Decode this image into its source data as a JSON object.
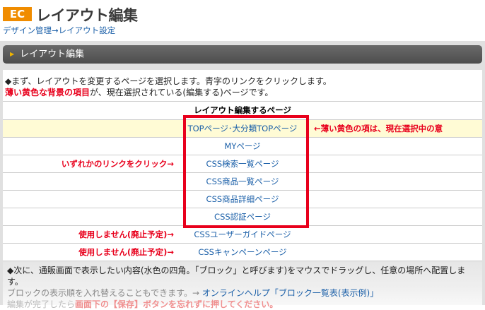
{
  "header": {
    "badge": "EC",
    "title": "レイアウト編集",
    "breadcrumb": "デザイン管理→レイアウト設定"
  },
  "section": {
    "title": "レイアウト編集"
  },
  "intro": {
    "line1": "◆まず、レイアウトを変更するページを選択します。青字のリンクをクリックします。",
    "line2_red": "薄い黄色な背景の項目",
    "line2_rest": "が、現在選択されている(編集する)ページです。"
  },
  "table": {
    "header": "レイアウト編集するページ",
    "rows": [
      {
        "label": "TOPページ･大分類TOPページ",
        "selected": true,
        "right_note": "←薄い黄色の項は、現在選択中の意"
      },
      {
        "label": "MYページ"
      },
      {
        "label": "CSS検索一覧ページ",
        "left_note": "いずれかのリンクをクリック→"
      },
      {
        "label": "CSS商品一覧ページ"
      },
      {
        "label": "CSS商品詳細ページ"
      },
      {
        "label": "CSS認証ページ"
      },
      {
        "label": "CSSユーザーガイドページ",
        "left_note": "使用しません(廃止予定)→"
      },
      {
        "label": "CSSキャンペーンページ",
        "left_note": "使用しません(廃止予定)→"
      }
    ]
  },
  "footer": {
    "line1": "◆次に、通販画面で表示したい内容(水色の四角。「ブロック」と呼びます)をマウスでドラッグし、任意の場所へ配置します。",
    "line2_text": "ブロックの表示順を入れ替えることもできます。→ ",
    "line2_link": "オンラインヘルプ「ブロック一覧表(表示例)」",
    "line3_text": "編集が完了したら",
    "line3_warn": "画面下の【保存】ボタンを忘れずに押してください。"
  },
  "colors": {
    "accent": "#f08c00",
    "red": "#e8001c",
    "link": "#1a5fa8",
    "selected_bg": "#fffbd5"
  }
}
